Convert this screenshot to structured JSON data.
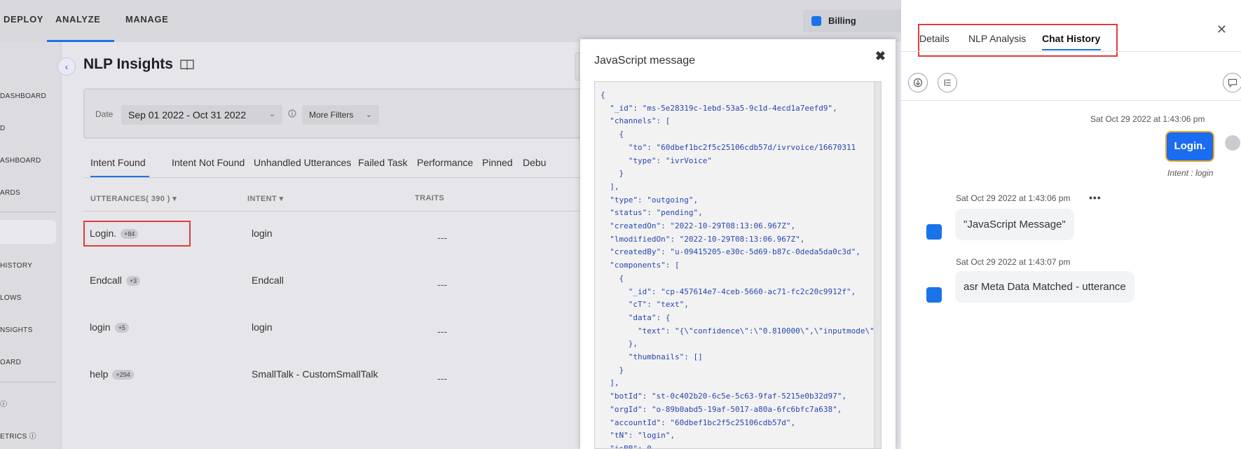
{
  "topnav": {
    "items": [
      "DEPLOY",
      "ANALYZE",
      "MANAGE"
    ],
    "billing_label": "Billing"
  },
  "sidebar": {
    "items": [
      "DASHBOARD",
      "D",
      "ASHBOARD",
      "ARDS",
      "HISTORY",
      "LOWS",
      "NSIGHTS",
      "OARD",
      "",
      "ETRICS"
    ]
  },
  "main": {
    "title": "NLP Insights",
    "filters": {
      "date_label": "Date",
      "date_value": "Sep 01 2022 - Oct 31 2022",
      "more_filters_label": "More Filters"
    },
    "tabs": [
      "Intent Found",
      "Intent Not Found",
      "Unhandled Utterances",
      "Failed Task",
      "Performance",
      "Pinned",
      "Debu"
    ],
    "columns": {
      "utterances": "UTTERANCES( 390 )",
      "intent": "INTENT",
      "traits": "TRAITS"
    },
    "rows": [
      {
        "utterance": "Login.",
        "count": "+84",
        "intent": "login",
        "traits": "---"
      },
      {
        "utterance": "Endcall",
        "count": "+3",
        "intent": "Endcall",
        "traits": "---"
      },
      {
        "utterance": "login",
        "count": "+5",
        "intent": "login",
        "traits": "---"
      },
      {
        "utterance": "help",
        "count": "+294",
        "intent": "SmallTalk - CustomSmallTalk",
        "traits": "---"
      }
    ]
  },
  "dialog": {
    "title": "JavaScript message",
    "close_label": "✖",
    "code": "{\n  \"_id\": \"ms-5e28319c-1ebd-53a5-9c1d-4ecd1a7eefd9\",\n  \"channels\": [\n    {\n      \"to\": \"60dbef1bc2f5c25106cdb57d/ivrvoice/16670311\n      \"type\": \"ivrVoice\"\n    }\n  ],\n  \"type\": \"outgoing\",\n  \"status\": \"pending\",\n  \"createdOn\": \"2022-10-29T08:13:06.967Z\",\n  \"lmodifiedOn\": \"2022-10-29T08:13:06.967Z\",\n  \"createdBy\": \"u-09415205-e30c-5d69-b87c-0deda5da0c3d\",\n  \"components\": [\n    {\n      \"_id\": \"cp-457614e7-4ceb-5660-ac71-fc2c20c9912f\",\n      \"cT\": \"text\",\n      \"data\": {\n        \"text\": \"{\\\"confidence\\\":\\\"0.810000\\\",\\\"inputmode\\\":\n      },\n      \"thumbnails\": []\n    }\n  ],\n  \"botId\": \"st-0c402b20-6c5e-5c63-9faf-5215e0b32d97\",\n  \"orgId\": \"o-89b0abd5-19af-5017-a80a-6fc6bfc7a638\",\n  \"accountId\": \"60dbef1bc2f5c25106cdb57d\",\n  \"tN\": \"login\",\n  \"isBB\": 0,"
  },
  "panel": {
    "tabs": [
      "Details",
      "NLP Analysis",
      "Chat History"
    ],
    "close_label": "✕",
    "messages": {
      "user_ts": "Sat Oct 29 2022 at 1:43:06 pm",
      "user_text": "Login.",
      "user_intent": "Intent : login",
      "bot1_ts": "Sat Oct 29 2022 at 1:43:06 pm",
      "bot1_text": "\"JavaScript Message\"",
      "bot2_ts": "Sat Oct 29 2022 at 1:43:07 pm",
      "bot2_text": "asr Meta Data Matched - utterance"
    },
    "more_label": "•••"
  }
}
